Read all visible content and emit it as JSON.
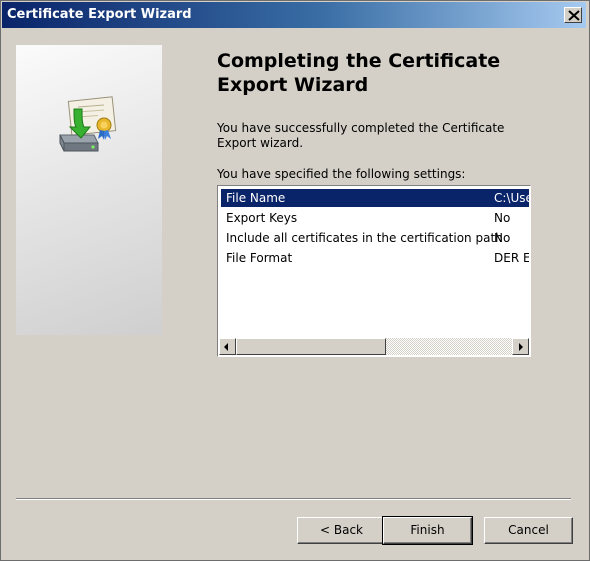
{
  "window": {
    "title": "Certificate Export Wizard",
    "close_icon": "close-icon"
  },
  "side_panel": {
    "icon": "certificate-export-icon"
  },
  "main": {
    "heading": "Completing the Certificate Export Wizard",
    "message": "You have successfully completed the Certificate Export wizard.",
    "settings_label": "You have specified the following settings:"
  },
  "settings_list": {
    "rows": [
      {
        "name": "File Name",
        "value": "C:\\Use",
        "selected": true
      },
      {
        "name": "Export Keys",
        "value": "No",
        "selected": false
      },
      {
        "name": "Include all certificates in the certification path",
        "value": "No",
        "selected": false
      },
      {
        "name": "File Format",
        "value": "DER Er",
        "selected": false
      }
    ]
  },
  "buttons": {
    "back": "< Back",
    "finish": "Finish",
    "cancel": "Cancel"
  },
  "colors": {
    "selection": "#0a246a",
    "face": "#d4d0c8"
  }
}
